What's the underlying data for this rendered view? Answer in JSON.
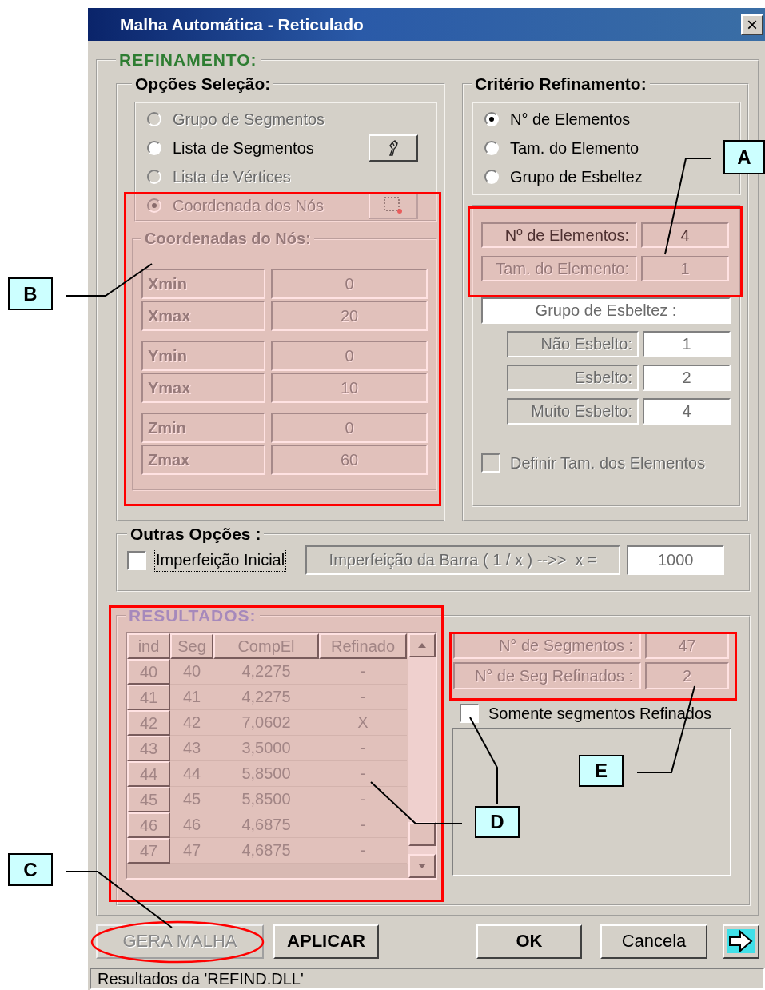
{
  "window": {
    "title": "Malha Automática - Reticulado",
    "close_glyph": "×"
  },
  "refinement": {
    "label": "REFINAMENTO:",
    "selection": {
      "label": "Opções Seleção:",
      "options": [
        {
          "label": "Grupo de Segmentos",
          "selected": false,
          "disabled": true,
          "kind": "plain"
        },
        {
          "label": "Lista de Segmentos",
          "selected": false,
          "disabled": false,
          "kind": "with_button"
        },
        {
          "label": "Lista de Vértices",
          "selected": false,
          "disabled": true,
          "kind": "plain"
        },
        {
          "label": "Coordenada dos Nós",
          "selected": true,
          "disabled": true,
          "kind": "with_button"
        }
      ],
      "coordinates": {
        "label": "Coordenadas do Nós:",
        "groups": [
          {
            "rows": [
              {
                "label": "Xmin",
                "value": "0"
              },
              {
                "label": "Xmax",
                "value": "20"
              }
            ]
          },
          {
            "rows": [
              {
                "label": "Ymin",
                "value": "0"
              },
              {
                "label": "Ymax",
                "value": "10"
              }
            ]
          },
          {
            "rows": [
              {
                "label": "Zmin",
                "value": "0"
              },
              {
                "label": "Zmax",
                "value": "60"
              }
            ]
          }
        ]
      }
    },
    "criteria": {
      "label": "Critério Refinamento:",
      "options": [
        {
          "label": "N° de Elementos",
          "selected": true,
          "disabled": false
        },
        {
          "label": "Tam. do Elemento",
          "selected": false,
          "disabled": false
        },
        {
          "label": "Grupo de Esbeltez",
          "selected": false,
          "disabled": false
        }
      ],
      "fields": [
        {
          "label": "Nº de Elementos:",
          "value": "4",
          "disabled": false
        },
        {
          "label": "Tam. do Elemento:",
          "value": "1",
          "disabled": true
        }
      ],
      "slenderness": {
        "label": "Grupo de Esbeltez :",
        "disabled": true,
        "rows": [
          {
            "label": "Não Esbelto:",
            "value": "1"
          },
          {
            "label": "Esbelto:",
            "value": "2"
          },
          {
            "label": "Muito Esbelto:",
            "value": "4"
          }
        ]
      },
      "define_size": {
        "label": "Definir Tam. dos Elementos",
        "checked": false,
        "disabled": true
      }
    }
  },
  "other_options": {
    "label": "Outras Opções :",
    "initial_imperfection": {
      "label": "Imperfeição Inicial",
      "checked": false,
      "focused": true
    },
    "bar_imperfection": {
      "label": "Imperfeição da Barra ( 1 / x ) -->>  x =",
      "value": "1000"
    }
  },
  "results": {
    "label": "RESULTADOS:",
    "table": {
      "columns": [
        "ind",
        "Seg",
        "CompEl",
        "Refinado"
      ],
      "rows": [
        [
          "40",
          "40",
          "4,2275",
          "-"
        ],
        [
          "41",
          "41",
          "4,2275",
          "-"
        ],
        [
          "42",
          "42",
          "7,0602",
          "X"
        ],
        [
          "43",
          "43",
          "3,5000",
          "-"
        ],
        [
          "44",
          "44",
          "5,8500",
          "-"
        ],
        [
          "45",
          "45",
          "5,8500",
          "-"
        ],
        [
          "46",
          "46",
          "4,6875",
          "-"
        ],
        [
          "47",
          "47",
          "4,6875",
          "-"
        ]
      ]
    },
    "summary": [
      {
        "label": "N° de Segmentos :",
        "value": "47"
      },
      {
        "label": "N° de Seg Refinados :",
        "value": "2"
      }
    ],
    "only_refined": {
      "label": "Somente segmentos Refinados",
      "checked": false
    }
  },
  "buttons": [
    {
      "kind": "text",
      "label": "GERA MALHA",
      "disabled": true,
      "bold": false
    },
    {
      "kind": "text",
      "label": "APLICAR",
      "disabled": false,
      "bold": true
    },
    {
      "kind": "text",
      "label": "OK",
      "disabled": false,
      "bold": true
    },
    {
      "kind": "text",
      "label": "Cancela",
      "disabled": false,
      "bold": false
    },
    {
      "kind": "icon",
      "disabled": false
    }
  ],
  "status_bar": "Resultados da 'REFIND.DLL'",
  "annotations": [
    {
      "label": "A"
    },
    {
      "label": "B"
    },
    {
      "label": "C"
    },
    {
      "label": "D"
    },
    {
      "label": "E"
    }
  ]
}
